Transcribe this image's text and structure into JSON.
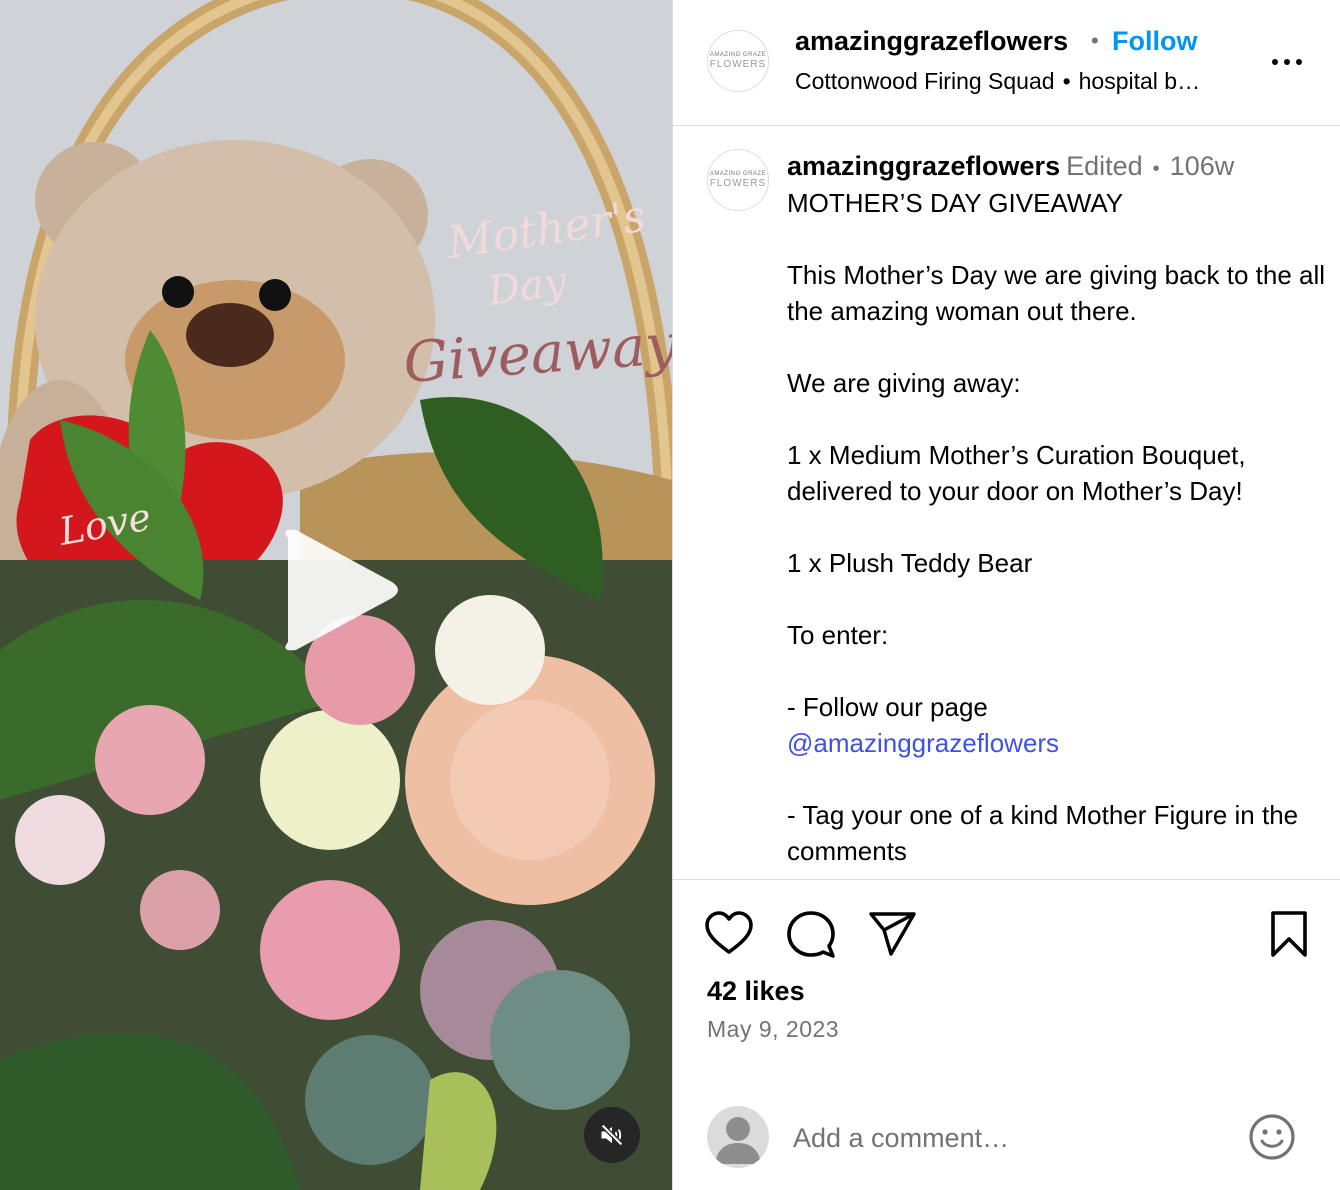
{
  "media": {
    "overlay_text": [
      "Mother's",
      "Day",
      "Giveaway"
    ],
    "heart_text": "Love",
    "play_icon": "play-icon",
    "mute_icon": "muted-speaker-icon"
  },
  "header": {
    "avatar_text": [
      "AMAZING GRAZE",
      "FLOWERS"
    ],
    "username": "amazinggrazeflowers",
    "separator": "•",
    "follow_label": "Follow",
    "audio": "Cottonwood Firing Squad",
    "location": "hospital b…"
  },
  "caption": {
    "username": "amazinggrazeflowers",
    "edited": "Edited",
    "separator": "•",
    "time": "106w",
    "lines": [
      "MOTHER’S DAY GIVEAWAY",
      "",
      "This Mother’s Day we are giving back to the all the amazing woman out there.",
      "",
      "We are giving away:",
      "",
      "1 x Medium Mother’s Curation Bouquet, delivered to your door on Mother’s Day!",
      "",
      "1 x Plush Teddy Bear",
      "",
      "To enter:",
      "",
      "- Follow our page"
    ],
    "mention": "@amazinggrazeflowers",
    "lines_after": [
      "",
      "- Tag your one of a kind Mother Figure in the comments"
    ]
  },
  "actions": {
    "likes": "42 likes",
    "date": "May 9, 2023",
    "comment_placeholder": "Add a comment…"
  },
  "colors": {
    "follow": "#0095f6",
    "mention": "#3f51e6",
    "muted_text": "#737373",
    "divider": "#dbdbdb"
  }
}
